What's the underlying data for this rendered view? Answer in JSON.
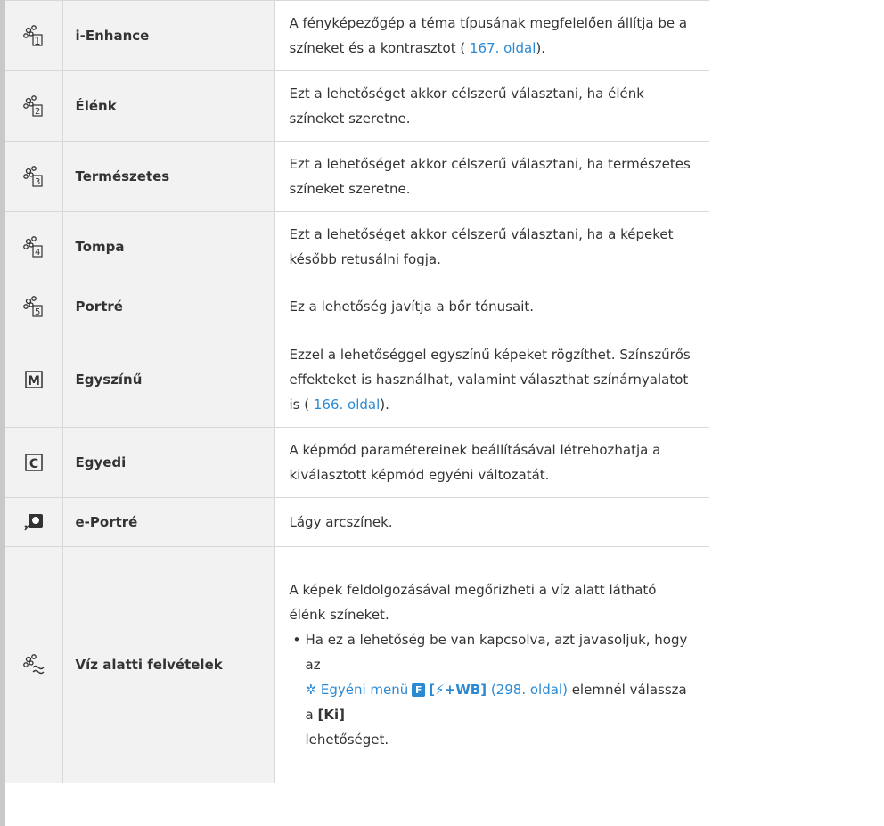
{
  "rows": [
    {
      "icon": "picture-mode-1-icon",
      "name": "i-Enhance",
      "desc_a": "A fényképezőgép a téma típusának megfelelően állítja be a színeket és a kontrasztot (",
      "link": " 167. oldal",
      "desc_b": ")."
    },
    {
      "icon": "picture-mode-2-icon",
      "name": "Élénk",
      "desc": "Ezt a lehetőséget akkor célszerű választani, ha élénk színeket szeretne."
    },
    {
      "icon": "picture-mode-3-icon",
      "name": "Természetes",
      "desc": "Ezt a lehetőséget akkor célszerű választani, ha természetes színeket szeretne."
    },
    {
      "icon": "picture-mode-4-icon",
      "name": "Tompa",
      "desc": "Ezt a lehetőséget akkor célszerű választani, ha a képeket később retusálni fogja."
    },
    {
      "icon": "picture-mode-5-icon",
      "name": "Portré",
      "desc": "Ez a lehetőség javítja a bőr tónusait."
    },
    {
      "icon": "monochrome-icon",
      "name": "Egyszínű",
      "desc_a": "Ezzel a lehetőséggel egyszínű képeket rögzíthet. Színszűrős effekteket is használhat, valamint választhat színárnyalatot is (",
      "link": " 166. oldal",
      "desc_b": ")."
    },
    {
      "icon": "custom-icon",
      "name": "Egyedi",
      "desc": "A képmód paramétereinek beállításával létrehozhatja a kiválasztott képmód egyéni változatát."
    },
    {
      "icon": "e-portrait-icon",
      "name": "e-Portré",
      "desc": "Lágy arcszínek."
    },
    {
      "icon": "underwater-icon",
      "name": "Víz alatti felvételek",
      "desc": "A képek feldolgozásával megőrizheti a víz alatt látható élénk színeket.",
      "bullet_a": "Ha ez a lehetőség be van kapcsolva, azt javasoljuk, hogy az",
      "menu_link": " Egyéni menü",
      "menu_tab": "F",
      "setting": "[ +WB]",
      "page_link": " (298. oldal)",
      "bullet_b": " elemnél válassza a ",
      "option": "[Ki]",
      "bullet_c": " lehetőséget."
    }
  ],
  "colors": {
    "accent": "#2b8ad4",
    "cell_bg": "#f2f2f2",
    "border": "#d8d8d8"
  }
}
